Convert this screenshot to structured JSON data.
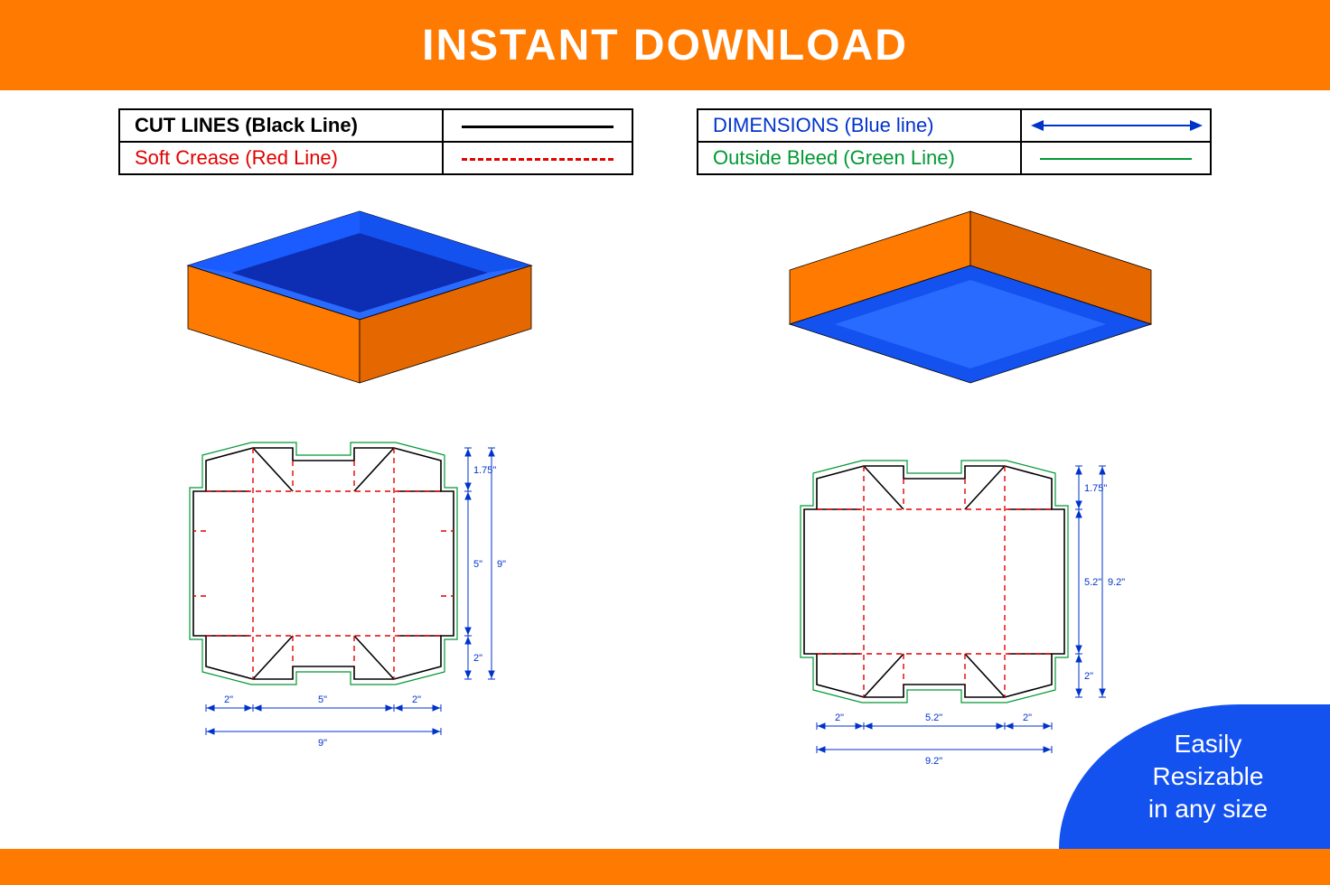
{
  "header": {
    "title": "INSTANT DOWNLOAD"
  },
  "legend": {
    "cut": "CUT LINES (Black Line)",
    "crease": "Soft Crease (Red Line)",
    "dimensions": "DIMENSIONS (Blue line)",
    "bleed": "Outside Bleed (Green Line)"
  },
  "dielines": {
    "left": {
      "top_flap": "1.75\"",
      "center_h": "5\"",
      "total_h": "9\"",
      "bottom_flap": "2\"",
      "left_flap_w": "2\"",
      "center_w": "5\"",
      "right_flap_w": "2\"",
      "total_w": "9\""
    },
    "right": {
      "top_flap": "1.75\"",
      "center_h": "5.2\"",
      "total_h": "9.2\"",
      "bottom_flap": "2\"",
      "left_flap_w": "2\"",
      "center_w": "5.2\"",
      "right_flap_w": "2\"",
      "total_w": "9.2\""
    }
  },
  "badge": {
    "line1": "Easily",
    "line2": "Resizable",
    "line3": "in any size"
  },
  "colors": {
    "orange": "#ff7a00",
    "orange_dark": "#e56700",
    "blue": "#1452f0",
    "blue_light": "#2a6bff",
    "blue_dark": "#0d2eb3",
    "red": "#e30000",
    "green": "#009933",
    "dim_blue": "#0033cc"
  }
}
